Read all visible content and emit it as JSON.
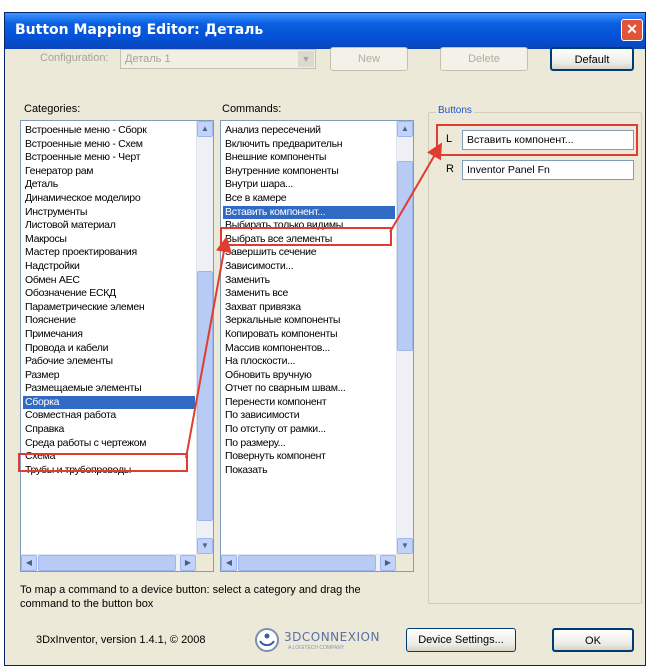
{
  "window": {
    "title": "Button Mapping Editor: Деталь",
    "close_glyph": "✕"
  },
  "configuration": {
    "label": "Configuration:",
    "value": "Деталь 1"
  },
  "toolbar": {
    "new_label": "New",
    "delete_label": "Delete",
    "default_label": "Default"
  },
  "categories": {
    "label": "Categories:",
    "items": [
      "Встроенные меню - Сборк",
      "Встроенные меню - Схем",
      "Встроенные меню - Черт",
      "Генератор рам",
      "Деталь",
      "Динамическое моделиро",
      "Инструменты",
      "Листовой материал",
      "Макросы",
      "Мастер проектирования",
      "Надстройки",
      "Обмен AEC",
      "Обозначение ЕСКД",
      "Параметрические элемен",
      "Пояснение",
      "Примечания",
      "Провода и кабели",
      "Рабочие элементы",
      "Размер",
      "Размещаемые элементы",
      "Сборка",
      "Совместная работа",
      "Справка",
      "Среда работы с чертежом",
      "Схема",
      "Трубы и трубопроводы"
    ],
    "selected_index": 20
  },
  "commands": {
    "label": "Commands:",
    "items": [
      "Анализ пересечений",
      "Включить предварительн",
      "Внешние компоненты",
      "Внутренние компоненты",
      "Внутри шара...",
      "Все в камере",
      "Вставить компонент...",
      "Выбирать только видимы",
      "Выбрать все элементы",
      "Завершить сечение",
      "Зависимости...",
      "Заменить",
      "Заменить все",
      "Захват привязка",
      "Зеркальные компоненты",
      "Копировать компоненты",
      "Массив компонентов...",
      "На плоскости...",
      "Обновить вручную",
      "Отчет по сварным швам...",
      "Перенести компонент",
      "По зависимости",
      "По отступу от рамки...",
      "По размеру...",
      "Повернуть компонент",
      "Показать"
    ],
    "selected_index": 6
  },
  "buttons": {
    "legend": "Buttons",
    "rows": [
      {
        "key": "L",
        "value": "Вставить компонент..."
      },
      {
        "key": "R",
        "value": "Inventor Panel Fn"
      }
    ]
  },
  "hint": "To map a command to a device button: select a category and drag the command to the button box",
  "footer": {
    "version": "3DxInventor, version 1.4.1, © 2008",
    "logo_text": "3DCONNEXION",
    "logo_sub": "A LOGITECH COMPANY",
    "device_settings_label": "Device Settings...",
    "ok_label": "OK"
  },
  "colors": {
    "annotation": "#e03c31",
    "selection": "#316ac5",
    "title_bar": "#0451d6"
  }
}
